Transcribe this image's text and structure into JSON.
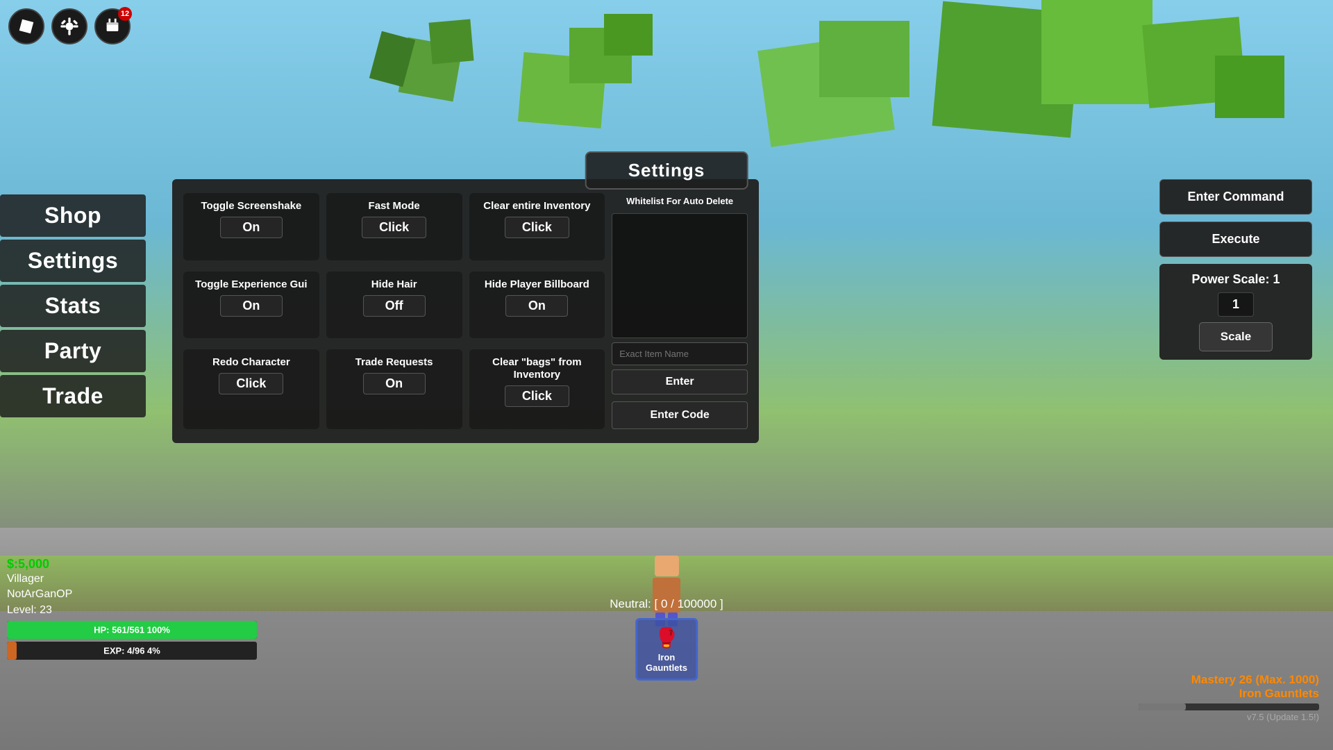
{
  "game": {
    "title": "Settings",
    "version": "v7.5 (Update 1.5!)"
  },
  "topbar": {
    "notification_count": "12"
  },
  "sidebar": {
    "items": [
      {
        "label": "Shop"
      },
      {
        "label": "Settings"
      },
      {
        "label": "Stats"
      },
      {
        "label": "Party"
      },
      {
        "label": "Trade"
      }
    ]
  },
  "settings": {
    "whitelist_title": "Whitelist For Auto Delete",
    "cells": [
      {
        "label": "Toggle Screenshake",
        "value": "On"
      },
      {
        "label": "Fast Mode",
        "value": "Click"
      },
      {
        "label": "Clear entire Inventory",
        "value": "Click"
      },
      {
        "label": "Toggle Experience Gui",
        "value": "On"
      },
      {
        "label": "Hide Hair",
        "value": "Off"
      },
      {
        "label": "Hide Player Billboard",
        "value": "On"
      },
      {
        "label": "Redo Character",
        "value": "Click"
      },
      {
        "label": "Trade Requests",
        "value": "On"
      },
      {
        "label": "Clear \"bags\" from Inventory",
        "value": "Click"
      }
    ],
    "exact_item_placeholder": "Exact Item Name",
    "enter_label": "Enter",
    "enter_code_label": "Enter Code"
  },
  "right_panel": {
    "enter_command_label": "Enter Command",
    "execute_label": "Execute",
    "power_scale_label": "Power Scale: 1",
    "power_scale_value": "1",
    "scale_label": "Scale"
  },
  "player": {
    "money": "$:5,000",
    "role": "Villager",
    "name": "NotArGanOP",
    "level": "Level: 23",
    "hp": "HP: 561/561 100%",
    "hp_percent": 100,
    "exp": "EXP: 4/96 4%",
    "exp_percent": 4
  },
  "neutral": {
    "text": "Neutral: [ 0 / 100000 ]"
  },
  "item": {
    "name": "Iron Gauntlets"
  },
  "mastery": {
    "text": "Mastery 26 (Max. 1000)",
    "item": "Iron Gauntlets",
    "percent": 26
  }
}
